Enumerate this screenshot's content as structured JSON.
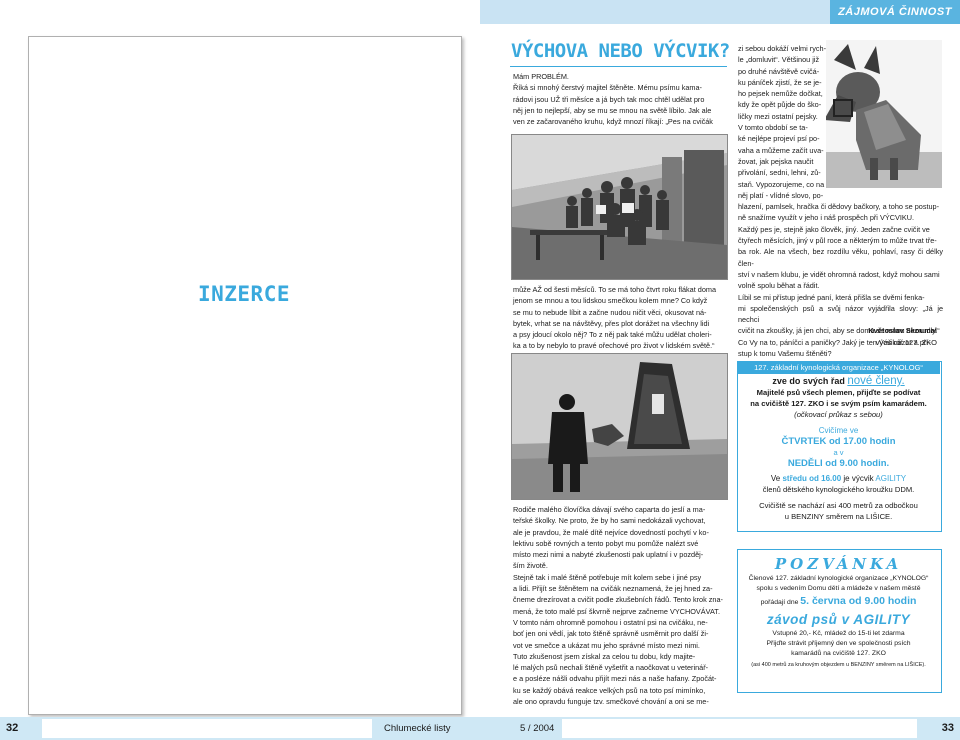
{
  "header": {
    "section_tag": "ZÁJMOVÁ ČINNOST"
  },
  "left_page": {
    "ad_label": "INZERCE"
  },
  "footer": {
    "page_left": "32",
    "page_right": "33",
    "magazine": "Chlumecké listy",
    "issue": "5 / 2004"
  },
  "article": {
    "title": "VÝCHOVA NEBO VÝCVIK?",
    "p1_lines": [
      "Mám PROBLÉM.",
      "Říká si mnohý čerstvý majitel štěněte. Mému psímu kama-",
      "rádovi jsou UŽ tři měsíce a já bych tak moc chtěl udělat pro",
      "něj jen to nejlepší, aby se mu se mnou na světě líbilo. Jak ale",
      "ven ze začarovaného kruhu, když mnozí říkají: „Pes na cvičák"
    ],
    "p2_lines": [
      "může AŽ od šesti měsíců. To se má toho čtvrt roku flákat doma",
      "jenom se mnou a tou lidskou smečkou kolem mne? Co když",
      "se mu to nebude líbit a začne nudou ničit věci, okusovat ná-",
      "bytek, vrhat se na návštěvy, přes plot dorážet na všechny lidi",
      "a psy jdoucí okolo něj? To z něj pak také můžu udělat choleri-",
      "ka a to by nebylo to pravé ořechové pro život v lidském světě.“"
    ],
    "p3_lines": [
      "Rodiče malého človíčka dávají svého caparta do jeslí a ma-",
      "teřské školky. Ne proto, že by ho sami nedokázali vychovat,",
      "ale je pravdou, že malé dítě nejvíce dovedností pochytí v ko-",
      "lektivu sobě rovných a tento pobyt mu pomůže nalézt své",
      "místo mezi nimi a nabyté zkušenosti pak uplatní i v pozděj-",
      "ším životě.",
      "Stejně tak i malé štěně potřebuje mít kolem sebe i jiné psy",
      "a lidi. Přijít se štěnětem na cvičák neznamená, že jej hned za-",
      "čneme drezírovat a cvičit podle zkušebních řádů. Tento krok zna-",
      "mená, že toto malé psí škvrně nejprve začneme VYCHOVÁVAT.",
      "V tomto nám ohromně pomohou i ostatní psi na cvičáku, ne-",
      "boť jen oni vědí, jak toto štěně správně usměrnit pro další ži-",
      "vot ve smečce a ukázat mu jeho správné místo mezi nimi.",
      "Tuto zkušenost jsem získal za celou tu dobu, kdy majite-",
      "lé malých psů nechali štěně vyšetřit a naočkovat u veterinář-",
      "e a posléze nášli odvahu přijít mezi nás a naše hafany. Zpočát-",
      "ku se každý obává reakce velkých psů na toto psí mimínko,",
      "ale ono opravdu funguje tzv. smečkové chování a oni se me-"
    ],
    "col2_lines": [
      "zi sebou dokáží velmi rych-",
      "le „domluvit“. Většinou již",
      "po druhé návštěvě cvičá-",
      "ku páníček zjistí, že se je-",
      "ho pejsek nemůže dočkat,",
      "kdy že opět půjde do ško-",
      "ličky mezi ostatní pejsky.",
      "V tomto období se ta-",
      "ké nejlépe projeví psí po-",
      "vaha a můžeme začít uva-",
      "žovat, jak pejska naučit",
      "přivolání, sedni, lehni, zů-",
      "staň. Vypozorujeme, co na",
      "něj platí - vlídné slovo, po-",
      "hlazení, pamlsek, hračka či dědovy bačkory, a toho se postup-",
      "ně snažíme využít v jeho i náš prospěch při VÝCVIKU.",
      "Každý pes je, stejně jako člověk, jiný. Jeden začne cvičit ve",
      "čtyřech měsících, jiný v půl roce a některým to může trvat tře-",
      "ba rok. Ale na všech, bez rozdílu věku, pohlaví, rasy či délky člen-",
      "ství v našem klubu, je vidět ohromná radost, když mohou sami",
      "volně spolu běhat a řádit.",
      "Líbil se mi přístup jedné paní, která přišla se dvěmi fenka-",
      "mi společenských psů a svůj názor vyjádřila slovy: „Já je nechci",
      "cvičit na zkoušky, já jen chci, aby se doma se mnou neznudly.“",
      "Co Vy na to, páníčci a paničky? Jaký je ten Váš názor a pří-",
      "stup k tomu Vašemu štěněti?"
    ],
    "author": "Květoslav Skoumal",
    "author_role": "výcvikář 127. ZKO"
  },
  "club_box": {
    "header": "127. základní kynologická organizace „KYNOLOG“",
    "l1a": "zve do svých řad ",
    "l1b": "nové členy.",
    "l2": "Majitelé psů všech plemen, přijďte se podívat",
    "l3": "na cvičiště 127. ZKO i se svým psím kamarádem.",
    "l4": "(očkovací průkaz s sebou)",
    "l5": "Cvičíme ve",
    "l6": "ČTVRTEK od 17.00 hodin",
    "l7": "a v",
    "l8": "NEDĚLI od 9.00 hodin.",
    "l9a": "Ve ",
    "l9b": "středu od 16.00",
    "l9c": " je výcvik ",
    "l9d": "AGILITY",
    "l10": "členů dětského kynologického kroužku DDM.",
    "l11": "Cvičiště se nachází asi 400 metrů za odbočkou",
    "l12": "u BENZINY směrem na LIŠICE."
  },
  "invite_box": {
    "title": "POZVÁNKA",
    "l1": "Členové 127. základní kynologické organizace „KYNOLOG“",
    "l2": "spolu s vedením Domu dětí a mládeže v našem městě",
    "l3a": "pořádají dne ",
    "l3b": "5. června od 9.00 hodin",
    "l4": "závod psů v AGILITY",
    "l5": "Vstupné 20,- Kč, mládež do 15-ti let zdarma",
    "l6": "Přijďte strávit příjemný den ve společnosti psích",
    "l7": "kamarádů na cvičiště 127. ZKO",
    "l8": "(asi 400 metrů za kruhovým objezdem u BENZINY směrem na LIŠICE)."
  },
  "images": {
    "photo1": "group-photo",
    "photo2": "dog-training-photo",
    "photo3": "german-shepherd-photo"
  },
  "colors": {
    "accent": "#3aa9dd",
    "band": "#c9e3f3"
  }
}
